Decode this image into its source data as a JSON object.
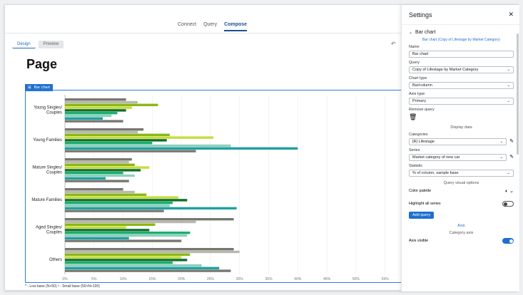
{
  "nav": {
    "tabs": [
      "Connect",
      "Query",
      "Compose"
    ],
    "active": "Compose"
  },
  "subtabs": {
    "design": "Design",
    "preview": "Preview"
  },
  "page_title": "Page",
  "chart_tag": "Bar chart",
  "footnote": "* - Low base (N<50)   ² - Small base (50<N<100)",
  "chart_data": {
    "type": "bar",
    "orientation": "horizontal",
    "categories": [
      "Young Singles/ Couples",
      "Young Families",
      "Mature Singles/ Couples",
      "Mature Families",
      "Aged Singles/ Couples",
      "Others"
    ],
    "xlim": [
      0,
      57
    ],
    "xticks": [
      "0%",
      "5%",
      "10%",
      "15%",
      "20%",
      "25%",
      "30%",
      "35%",
      "40%",
      "45%",
      "50%",
      "55%"
    ],
    "colors": [
      "#76776f",
      "#b8b8b0",
      "#8ab714",
      "#c5dc3a",
      "#0d6e2c",
      "#1cae6f",
      "#8ed1bf",
      "#20a0a0"
    ],
    "series": [
      {
        "values": [
          10.5,
          13.5,
          11.5,
          10.0,
          29.0,
          29.0
        ]
      },
      {
        "values": [
          12.5,
          12.5,
          11.0,
          12.0,
          22.5,
          30.0
        ]
      },
      {
        "values": [
          16.0,
          18.0,
          12.0,
          14.0,
          15.5,
          21.5
        ]
      },
      {
        "values": [
          11.5,
          25.5,
          14.5,
          19.5,
          10.5,
          20.0
        ]
      },
      {
        "values": [
          10.5,
          17.5,
          13.0,
          21.0,
          14.5,
          21.0
        ]
      },
      {
        "values": [
          9.0,
          15.0,
          10.0,
          18.5,
          21.5,
          18.5
        ]
      },
      {
        "values": [
          8.0,
          28.5,
          12.0,
          18.0,
          21.0,
          23.5
        ]
      },
      {
        "values": [
          6.5,
          40.0,
          7.0,
          29.5,
          11.0,
          26.5
        ]
      },
      {
        "values": [
          10.0,
          22.5,
          11.0,
          17.0,
          20.0,
          28.5
        ]
      }
    ]
  },
  "settings": {
    "title": "Settings",
    "section_title": "Bar chart",
    "subtitle": "Bar chart (Copy of Lifestage by Market Category)",
    "name_label": "Name",
    "name_value": "Bar chart",
    "query_label": "Query",
    "query_value": "Copy of Lifestage by Market Category",
    "charttype_label": "Chart type",
    "charttype_value": "Bar/column",
    "axistype_label": "Axis type",
    "axistype_value": "Primary",
    "remove_label": "Remove query",
    "display_label": "Display data",
    "categories_label": "Categories",
    "categories_value": "[R] Lifestage",
    "series_label": "Series",
    "series_value": "Market category of new car",
    "statistic_label": "Statistic",
    "statistic_value": "% of column, sample base",
    "visual_label": "Query visual options",
    "palette_label": "Color palette",
    "highlight_label": "Highlight all series",
    "add_query": "Add query",
    "axis_label": "Axis",
    "catAxis_label": "Category axis",
    "axisvisible_label": "Axis visible"
  }
}
